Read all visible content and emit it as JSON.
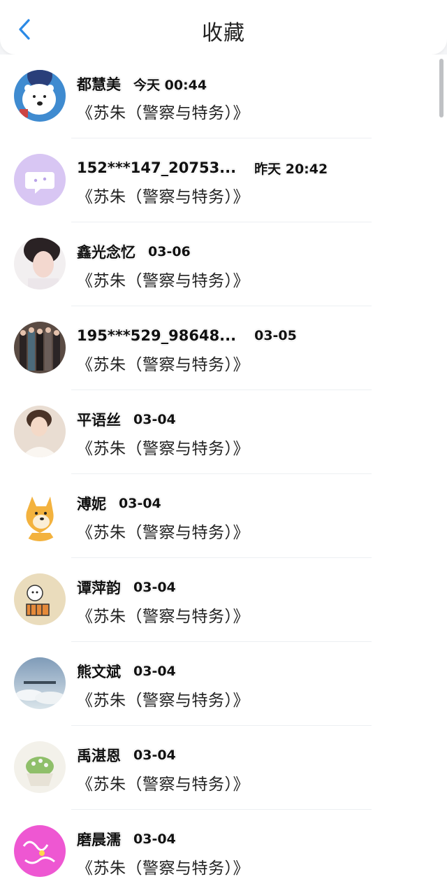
{
  "header": {
    "title": "收藏",
    "back_icon": "chevron-left-icon",
    "accent": "#2b8ae6"
  },
  "items": [
    {
      "name": "都慧美",
      "time": "今天 00:44",
      "content": "《苏朱（警察与特务）》",
      "avatar": "polar-bear"
    },
    {
      "name": "152***147_20753...",
      "time": "昨天 20:42",
      "content": "《苏朱（警察与特务）》",
      "avatar": "chat-bubble"
    },
    {
      "name": "鑫光念忆",
      "time": "03-06",
      "content": "《苏朱（警察与特务）》",
      "avatar": "person-photo"
    },
    {
      "name": "195***529_98648...",
      "time": "03-05",
      "content": "《苏朱（警察与特务）》",
      "avatar": "group-photo"
    },
    {
      "name": "平语丝",
      "time": "03-04",
      "content": "《苏朱（警察与特务）》",
      "avatar": "person-photo"
    },
    {
      "name": "溥妮",
      "time": "03-04",
      "content": "《苏朱（警察与特务）》",
      "avatar": "doge"
    },
    {
      "name": "谭萍韵",
      "time": "03-04",
      "content": "《苏朱（警察与特务）》",
      "avatar": "tiger-cartoon"
    },
    {
      "name": "熊文斌",
      "time": "03-04",
      "content": "《苏朱（警察与特务）》",
      "avatar": "sky-photo"
    },
    {
      "name": "禹湛恩",
      "time": "03-04",
      "content": "《苏朱（警察与特务）》",
      "avatar": "plant-photo"
    },
    {
      "name": "磨晨濡",
      "time": "03-04",
      "content": "《苏朱（警察与特务）》",
      "avatar": "pink-doodle"
    }
  ]
}
